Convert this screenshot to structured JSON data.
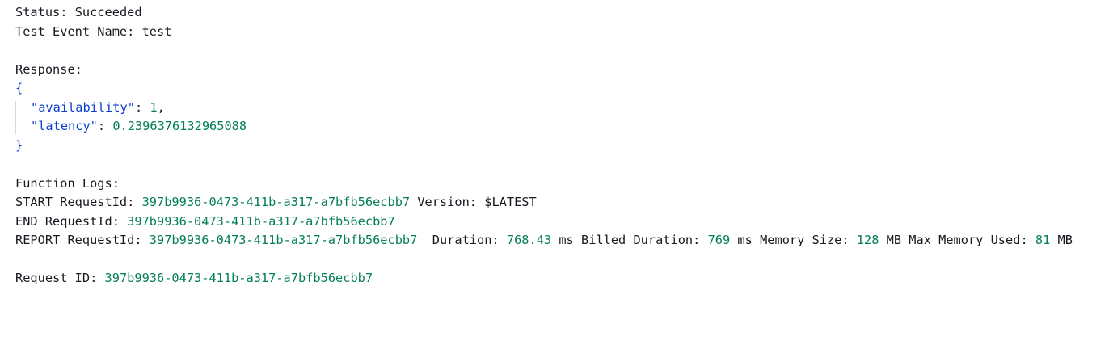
{
  "status": {
    "label": "Status:",
    "value": "Succeeded"
  },
  "test_event": {
    "label": "Test Event Name:",
    "value": "test"
  },
  "response": {
    "label": "Response:",
    "open_brace": "{",
    "close_brace": "}",
    "fields": [
      {
        "key": "\"availability\"",
        "value": "1",
        "sep": ",",
        "colon": ":"
      },
      {
        "key": "\"latency\"",
        "value": "0.2396376132965088",
        "sep": "",
        "colon": ":"
      }
    ]
  },
  "function_logs": {
    "label": "Function Logs:",
    "start": {
      "prefix": "START RequestId:",
      "request_id": "397b9936-0473-411b-a317-a7bfb56ecbb7",
      "version_label": "Version:",
      "version": "$LATEST"
    },
    "end": {
      "prefix": "END RequestId:",
      "request_id": "397b9936-0473-411b-a317-a7bfb56ecbb7"
    },
    "report": {
      "prefix": "REPORT RequestId:",
      "request_id": "397b9936-0473-411b-a317-a7bfb56ecbb7",
      "duration_label": "Duration:",
      "duration": "768.43",
      "duration_unit": "ms",
      "billed_label": "Billed Duration:",
      "billed": "769",
      "billed_unit": "ms",
      "memory_label": "Memory Size:",
      "memory": "128",
      "memory_unit": "MB",
      "max_memory_label": "Max Memory Used:",
      "max_memory": "81",
      "max_memory_unit": "MB"
    }
  },
  "request": {
    "label": "Request ID:",
    "value": "397b9936-0473-411b-a317-a7bfb56ecbb7"
  },
  "colors": {
    "text": "#16191f",
    "key": "#0b3ecf",
    "number": "#037f51"
  }
}
